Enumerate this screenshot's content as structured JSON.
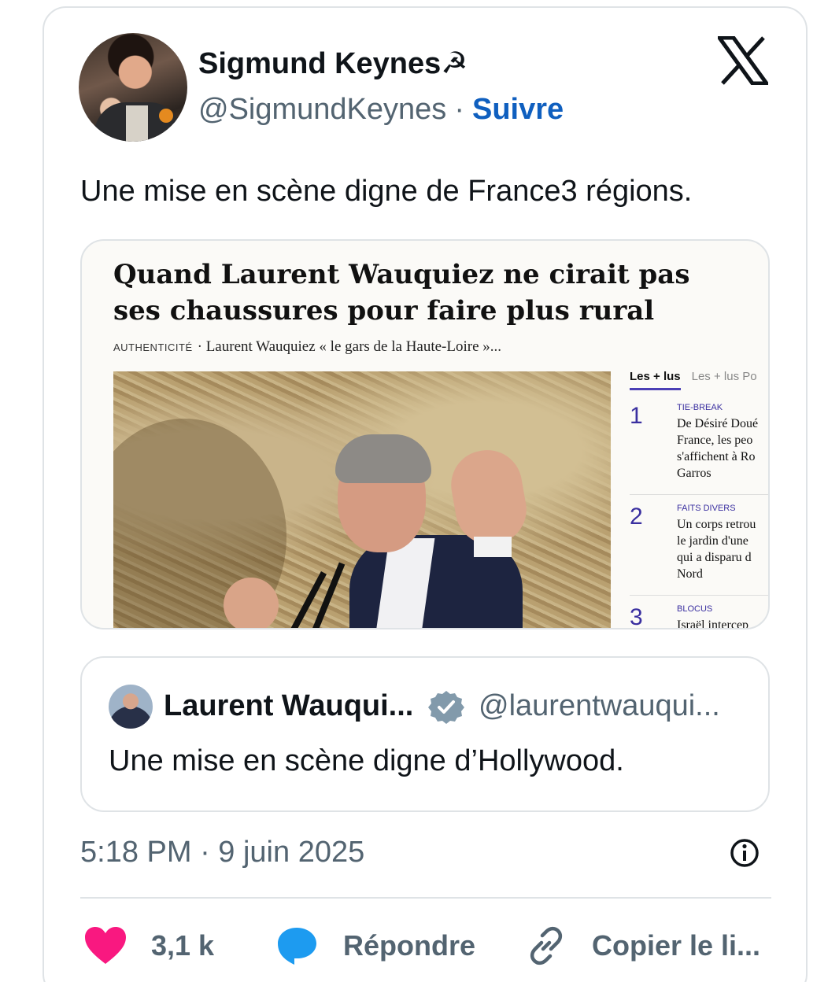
{
  "author": {
    "display_name": "Sigmund Keynes☭",
    "handle": "@SigmundKeynes",
    "separator": "·",
    "follow_label": "Suivre"
  },
  "tweet": {
    "text": "Une mise en scène digne de France3 régions.",
    "timestamp": "5:18 PM · 9 juin 2025"
  },
  "article": {
    "headline": "Quand Laurent Wauquiez ne cirait pas ses chaussures pour faire plus rural",
    "kicker_label": "AUTHENTICITÉ",
    "kicker_sub": "· Laurent Wauquiez « le gars de la Haute-Loire »...",
    "sidebar": {
      "tab_active": "Les + lus",
      "tab_other": "Les + lus Po",
      "items": [
        {
          "num": "1",
          "category": "TIE-BREAK",
          "title": "De Désiré Doué\nFrance, les peo\ns'affichent à Ro\nGarros"
        },
        {
          "num": "2",
          "category": "FAITS DIVERS",
          "title": "Un corps retrou\nle jardin d'une\nqui a disparu d\nNord"
        },
        {
          "num": "3",
          "category": "BLOCUS",
          "title": "Israël intercep"
        }
      ]
    }
  },
  "quote": {
    "display_name": "Laurent Wauqui...",
    "handle": "@laurentwauqui...",
    "text": "Une mise en scène digne d’Hollywood."
  },
  "actions": {
    "like_count": "3,1 k",
    "reply_label": "Répondre",
    "copy_label": "Copier le li..."
  },
  "colors": {
    "link_blue": "#0f5fbf",
    "like_pink": "#f91880",
    "reply_blue": "#1d9bf0",
    "verified_gray": "#829aab",
    "muted_text": "#536471"
  },
  "icons": {
    "brand": "x-logo-icon",
    "handle_symbol": "hammer-sickle",
    "verified": "verified-badge-icon",
    "info": "info-icon",
    "like": "heart-icon",
    "reply": "speech-bubble-icon",
    "copy": "link-icon"
  }
}
